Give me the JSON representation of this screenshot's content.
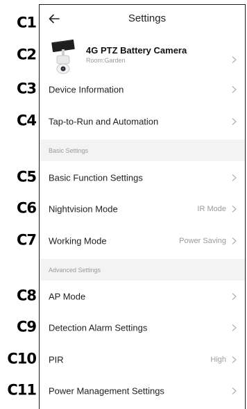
{
  "callouts": [
    "C1",
    "C2",
    "C3",
    "C4",
    "C5",
    "C6",
    "C7",
    "C8",
    "C9",
    "C10",
    "C11"
  ],
  "header": {
    "title": "Settings"
  },
  "device": {
    "name": "4G PTZ Battery Camera",
    "room": "Room:Garden"
  },
  "rows": [
    {
      "label": "Device Information",
      "value": ""
    },
    {
      "label": "Tap-to-Run and Automation",
      "value": ""
    }
  ],
  "sections": {
    "basic": "Basic Settings",
    "advanced": "Advanced Settings"
  },
  "basic_rows": [
    {
      "label": "Basic Function Settings",
      "value": ""
    },
    {
      "label": "Nightvision Mode",
      "value": "IR Mode"
    },
    {
      "label": "Working Mode",
      "value": "Power Saving"
    }
  ],
  "advanced_rows": [
    {
      "label": "AP Mode",
      "value": ""
    },
    {
      "label": "Detection Alarm Settings",
      "value": ""
    },
    {
      "label": "PIR",
      "value": "High"
    },
    {
      "label": "Power Management Settings",
      "value": ""
    }
  ],
  "icons": {
    "back": "arrow-left-icon",
    "chevron": "chevron-right-icon",
    "device": "camera-thumbnail"
  },
  "colors": {
    "text": "#222222",
    "secondary": "#9a9a9a",
    "section_bg": "#f3f3f3",
    "chevron": "#b0b0b0"
  }
}
